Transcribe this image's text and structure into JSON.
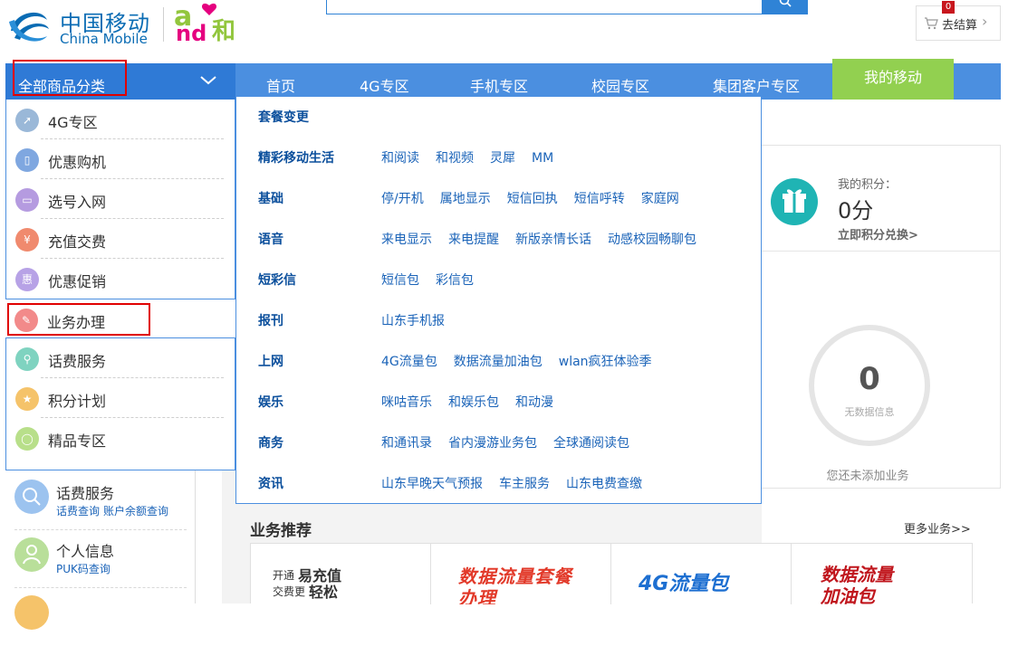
{
  "header": {
    "logo_cn": "中国移动",
    "logo_en": "China Mobile",
    "brand_a": "a",
    "brand_nd": "nd",
    "brand_he": "和",
    "cart_count": "0",
    "cart_label": "去结算",
    "cart_arrow": "›"
  },
  "nav": {
    "category_title": "全部商品分类",
    "items": [
      "首页",
      "4G专区",
      "手机专区",
      "校园专区",
      "集团客户专区"
    ],
    "mine": "我的移动"
  },
  "categories": [
    {
      "label": "4G专区",
      "icon": "rocket-icon",
      "color": "#9ab8d8",
      "glyph": "➚"
    },
    {
      "label": "优惠购机",
      "icon": "phone-icon",
      "color": "#7fa7e0",
      "glyph": "▯"
    },
    {
      "label": "选号入网",
      "icon": "sim-card-icon",
      "color": "#b59be0",
      "glyph": "▭"
    },
    {
      "label": "充值交费",
      "icon": "yen-icon",
      "color": "#f08a6e",
      "glyph": "¥"
    },
    {
      "label": "优惠促销",
      "icon": "promo-icon",
      "color": "#b7a2e6",
      "glyph": "惠"
    },
    {
      "label": "业务办理",
      "icon": "pencil-icon",
      "color": "#f28a8a",
      "glyph": "✎"
    },
    {
      "label": "话费服务",
      "icon": "search-icon",
      "color": "#7fd3c0",
      "glyph": "⚲"
    },
    {
      "label": "积分计划",
      "icon": "points-icon",
      "color": "#f5c36a",
      "glyph": "★"
    },
    {
      "label": "精品专区",
      "icon": "mouse-icon",
      "color": "#b8df8a",
      "glyph": "◯"
    }
  ],
  "submenu": [
    {
      "cat": "套餐变更",
      "links": []
    },
    {
      "cat": "精彩移动生活",
      "links": [
        "和阅读",
        "和视频",
        "灵犀",
        "MM"
      ]
    },
    {
      "cat": "基础",
      "links": [
        "停/开机",
        "属地显示",
        "短信回执",
        "短信呼转",
        "家庭网"
      ]
    },
    {
      "cat": "语音",
      "links": [
        "来电显示",
        "来电提醒",
        "新版亲情长话",
        "动感校园畅聊包"
      ]
    },
    {
      "cat": "短彩信",
      "links": [
        "短信包",
        "彩信包"
      ]
    },
    {
      "cat": "报刊",
      "links": [
        "山东手机报"
      ]
    },
    {
      "cat": "上网",
      "links": [
        "4G流量包",
        "数据流量加油包",
        "wlan疯狂体验季"
      ]
    },
    {
      "cat": "娱乐",
      "links": [
        "咪咕音乐",
        "和娱乐包",
        "和动漫"
      ]
    },
    {
      "cat": "商务",
      "links": [
        "和通讯录",
        "省内漫游业务包",
        "全球通阅读包"
      ]
    },
    {
      "cat": "资讯",
      "links": [
        "山东早晚天气预报",
        "车主服务",
        "山东电费查缴"
      ]
    }
  ],
  "points": {
    "label": "我的积分：",
    "value": "0分",
    "link": "立即积分兑换>"
  },
  "business": {
    "count": "0",
    "sub": "无数据信息",
    "footer": "您还未添加业务"
  },
  "services": [
    {
      "title": "话费服务",
      "links": [
        "话费查询",
        "账户余额查询"
      ],
      "color": "#9cc3ef"
    },
    {
      "title": "个人信息",
      "links": [
        "PUK码查询"
      ],
      "color": "#b9df9a"
    }
  ],
  "recommend": {
    "title": "业务推荐",
    "more": "更多业务>>",
    "card1": {
      "small1": "开通",
      "big1": "易充值",
      "small2": "交费更",
      "big2": "轻松"
    },
    "card2": "数据流量套餐办理",
    "card3": "4G流量包",
    "card4": "数据流量加油包"
  },
  "colors": {
    "nav_blue": "#4b8fe0",
    "category_blue": "#2f7ad6",
    "mine_green": "#92d050",
    "link_blue": "#1a63b8",
    "highlight_red": "#e00000"
  }
}
